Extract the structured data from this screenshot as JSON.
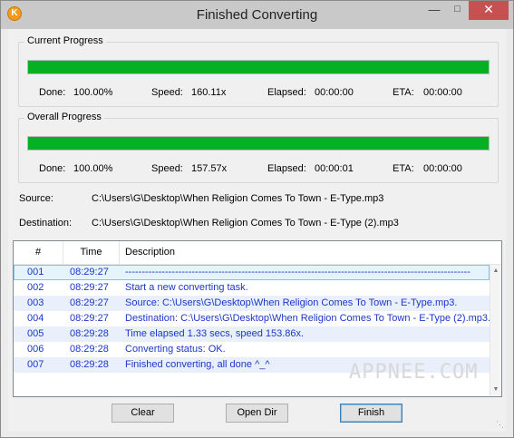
{
  "window": {
    "title": "Finished Converting",
    "icon": "app-k-icon"
  },
  "current": {
    "legend": "Current Progress",
    "progress": 1.0,
    "done_label": "Done:",
    "done": "100.00%",
    "speed_label": "Speed:",
    "speed": "160.11x",
    "elapsed_label": "Elapsed:",
    "elapsed": "00:00:00",
    "eta_label": "ETA:",
    "eta": "00:00:00"
  },
  "overall": {
    "legend": "Overall Progress",
    "progress": 1.0,
    "done_label": "Done:",
    "done": "100.00%",
    "speed_label": "Speed:",
    "speed": "157.57x",
    "elapsed_label": "Elapsed:",
    "elapsed": "00:00:01",
    "eta_label": "ETA:",
    "eta": "00:00:00"
  },
  "source": {
    "label": "Source:",
    "value": "C:\\Users\\G\\Desktop\\When Religion Comes To Town - E-Type.mp3"
  },
  "destination": {
    "label": "Destination:",
    "value": "C:\\Users\\G\\Desktop\\When Religion Comes To Town - E-Type (2).mp3"
  },
  "log": {
    "columns": [
      "#",
      "Time",
      "Description"
    ],
    "rows": [
      {
        "num": "001",
        "time": "08:29:27",
        "desc": "--------------------------------------------------------------------------------------------------------"
      },
      {
        "num": "002",
        "time": "08:29:27",
        "desc": "Start a new converting task."
      },
      {
        "num": "003",
        "time": "08:29:27",
        "desc": "Source:  C:\\Users\\G\\Desktop\\When Religion Comes To Town - E-Type.mp3."
      },
      {
        "num": "004",
        "time": "08:29:27",
        "desc": "Destination: C:\\Users\\G\\Desktop\\When Religion Comes To Town - E-Type (2).mp3."
      },
      {
        "num": "005",
        "time": "08:29:28",
        "desc": "Time elapsed 1.33 secs, speed 153.86x."
      },
      {
        "num": "006",
        "time": "08:29:28",
        "desc": "Converting status: OK."
      },
      {
        "num": "007",
        "time": "08:29:28",
        "desc": "Finished converting, all done ^_^"
      }
    ]
  },
  "watermark": "APPNEE.COM",
  "buttons": {
    "clear": "Clear",
    "open_dir": "Open Dir",
    "finish": "Finish"
  }
}
